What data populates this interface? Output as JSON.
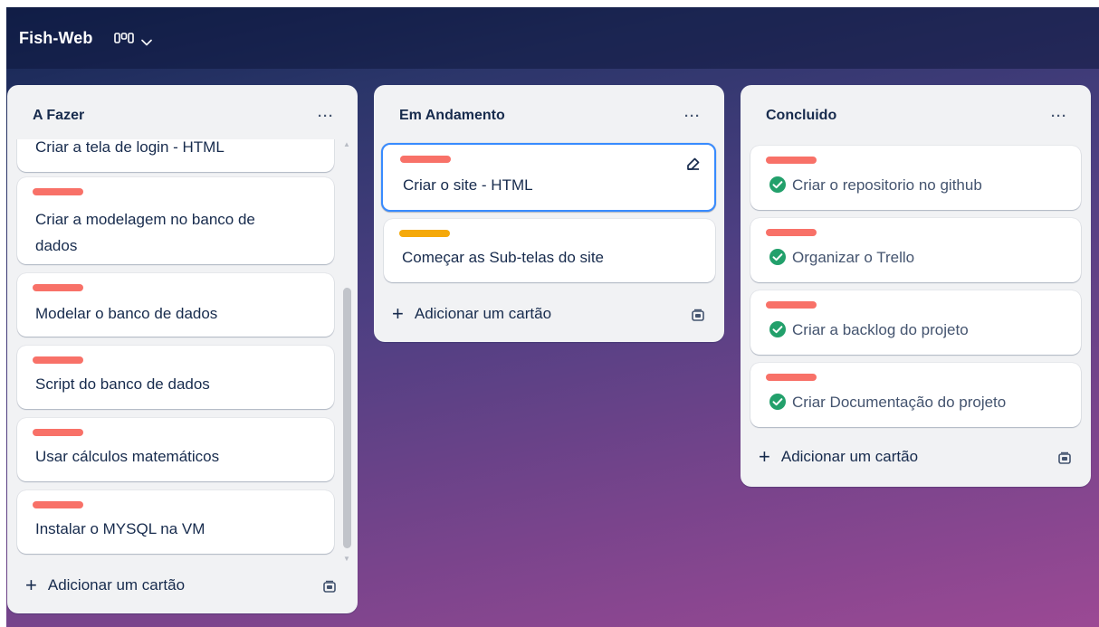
{
  "board": {
    "title": "Fish-Web",
    "view_icon": "board-view-icon",
    "view_menu_icon": "chevron-down-icon"
  },
  "colors": {
    "label_red": "#f87168",
    "label_yellow": "#f5a90a",
    "check_green": "#22a06b",
    "edit_border": "#388bff"
  },
  "lists": [
    {
      "title": "A Fazer",
      "menu": "···",
      "cards": [
        {
          "text": "Criar a tela de login - HTML",
          "label": "red"
        },
        {
          "text": "Criar a modelagem no banco de dados",
          "label": "red"
        },
        {
          "text": "Modelar o banco de dados",
          "label": "red"
        },
        {
          "text": "Script do banco de dados",
          "label": "red"
        },
        {
          "text": "Usar cálculos matemáticos",
          "label": "red"
        },
        {
          "text": "Instalar o MYSQL na VM",
          "label": "red"
        }
      ],
      "add_card": "Adicionar um cartão"
    },
    {
      "title": "Em Andamento",
      "menu": "···",
      "cards": [
        {
          "text": "Criar o site - HTML",
          "label": "red",
          "editing": true
        },
        {
          "text": "Começar as Sub-telas do site",
          "label": "yellow"
        }
      ],
      "add_card": "Adicionar um cartão"
    },
    {
      "title": "Concluido",
      "menu": "···",
      "cards": [
        {
          "text": "Criar o repositorio no github",
          "label": "red",
          "done": true
        },
        {
          "text": "Organizar o Trello",
          "label": "red",
          "done": true
        },
        {
          "text": "Criar a backlog do projeto",
          "label": "red",
          "done": true
        },
        {
          "text": "Criar Documentação do projeto",
          "label": "red",
          "done": true
        }
      ],
      "add_card": "Adicionar um cartão"
    }
  ]
}
